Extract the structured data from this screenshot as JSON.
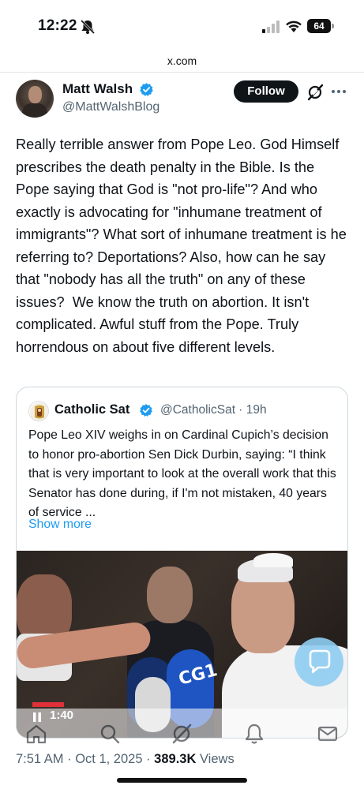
{
  "status_bar": {
    "time": "12:22",
    "battery": "64"
  },
  "browser": {
    "url": "x.com"
  },
  "tweet": {
    "author_name": "Matt Walsh",
    "author_handle": "@MattWalshBlog",
    "follow_label": "Follow",
    "text": "Really terrible answer from Pope Leo. God Himself prescribes the death penalty in the Bible. Is the Pope saying that God is \"not pro-life\"? And who exactly is advocating for \"inhumane treatment of immigrants\"? What sort of inhumane treatment is he referring to? Deportations? Also, how can he say that \"nobody has all the truth\" on any of these issues?  We know the truth on abortion. It isn't complicated. Awful stuff from the Pope. Truly horrendous on about five different levels.",
    "timestamp": "7:51 AM · Oct 1, 2025 · ",
    "views_count": "389.3K",
    "views_label": " Views"
  },
  "quoted_tweet": {
    "author_name": "Catholic Sat",
    "author_handle": "@CatholicSat · 19h",
    "text": "Pope Leo XIV weighs in on Cardinal Cupich’s decision to honor pro-abortion Sen Dick Durbin, saying: “I think that is very important to look at the overall work that this Senator has done during, if I'm not mistaken, 40 years of service ...",
    "show_more": "Show more",
    "video": {
      "elapsed": "1:40",
      "mic_label": "CG1"
    }
  },
  "colors": {
    "accent": "#1d9bf0",
    "text_primary": "#0f1419",
    "text_secondary": "#536471",
    "verified": "#1d9bf0"
  },
  "icons": [
    "bell-off-icon",
    "signal-icon",
    "wifi-icon",
    "battery-icon",
    "verified-badge-icon",
    "grok-icon",
    "more-icon",
    "pause-icon",
    "chat-icon",
    "home-icon",
    "search-icon",
    "notifications-icon",
    "messages-icon"
  ]
}
